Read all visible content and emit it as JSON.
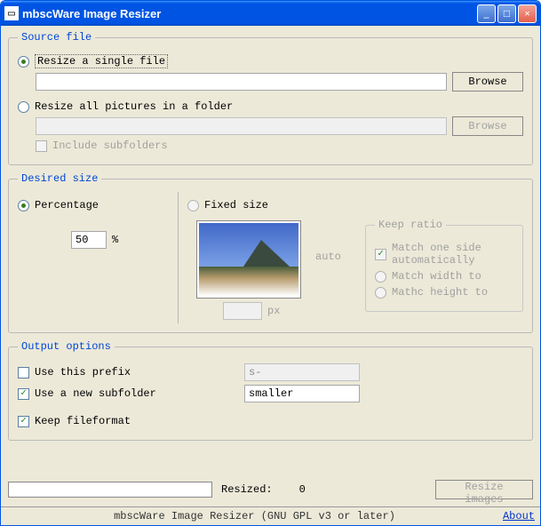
{
  "window": {
    "title": "mbscWare Image Resizer"
  },
  "source": {
    "legend": "Source file",
    "single_label": "Resize a single file",
    "folder_label": "Resize all pictures in a folder",
    "include_subfolders": "Include subfolders",
    "browse": "Browse",
    "single_value": "",
    "folder_value": ""
  },
  "size": {
    "legend": "Desired size",
    "percentage_label": "Percentage",
    "percent_value": "50",
    "percent_unit": "%",
    "fixed_label": "Fixed size",
    "auto": "auto",
    "px": "px",
    "px_value": "",
    "keep_ratio": {
      "legend": "Keep ratio",
      "match_auto": "Match one side automatically",
      "match_width": "Match width to",
      "match_height": "Mathc height to"
    }
  },
  "output": {
    "legend": "Output options",
    "use_prefix": "Use this prefix",
    "prefix_value": "s-",
    "use_subfolder": "Use a new subfolder",
    "subfolder_value": "smaller",
    "keep_format": "Keep fileformat"
  },
  "bottom": {
    "resized_label": "Resized:",
    "resized_count": "0",
    "resize_btn": "Resize images"
  },
  "footer": {
    "credit": "mbscWare Image Resizer (GNU GPL v3 or later)",
    "about": "About"
  }
}
